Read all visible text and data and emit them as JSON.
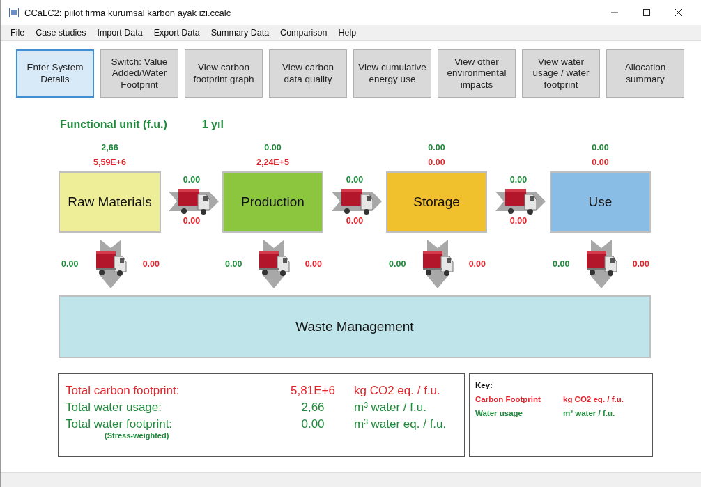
{
  "window": {
    "title": "CCaLC2: piilot firma kurumsal karbon ayak izi.ccalc"
  },
  "menu": [
    "File",
    "Case studies",
    "Import Data",
    "Export Data",
    "Summary Data",
    "Comparison",
    "Help"
  ],
  "toolbar": [
    {
      "label": "Enter System Details",
      "selected": true
    },
    {
      "label": "Switch: Value Added/Water Footprint",
      "selected": false
    },
    {
      "label": "View carbon footprint graph",
      "selected": false
    },
    {
      "label": "View carbon data quality",
      "selected": false
    },
    {
      "label": "View cumulative energy use",
      "selected": false
    },
    {
      "label": "View other environmental impacts",
      "selected": false
    },
    {
      "label": "View water usage / water footprint",
      "selected": false
    },
    {
      "label": "Allocation summary",
      "selected": false
    }
  ],
  "functional_unit": {
    "label": "Functional unit (f.u.)",
    "value": "1 yıl"
  },
  "stages": [
    {
      "name": "Raw Materials",
      "color": "#eeee99",
      "water": "2,66",
      "carbon": "5,59E+6",
      "transport": {
        "water": "0.00",
        "carbon": "0.00"
      },
      "waste_transport": {
        "water": "0.00",
        "carbon": "0.00"
      }
    },
    {
      "name": "Production",
      "color": "#8cc63f",
      "water": "0.00",
      "carbon": "2,24E+5",
      "transport": {
        "water": "0.00",
        "carbon": "0.00"
      },
      "waste_transport": {
        "water": "0.00",
        "carbon": "0.00"
      }
    },
    {
      "name": "Storage",
      "color": "#f0c12c",
      "water": "0.00",
      "carbon": "0.00",
      "transport": {
        "water": "0.00",
        "carbon": "0.00"
      },
      "waste_transport": {
        "water": "0.00",
        "carbon": "0.00"
      }
    },
    {
      "name": "Use",
      "color": "#89bde6",
      "water": "0.00",
      "carbon": "0.00",
      "waste_transport": {
        "water": "0.00",
        "carbon": "0.00"
      }
    }
  ],
  "waste_management": "Waste Management",
  "totals": [
    {
      "kind": "carbon",
      "label": "Total carbon footprint:",
      "value": "5,81E+6",
      "unit": "kg CO2 eq. / f.u."
    },
    {
      "kind": "water",
      "label": "Total water usage:",
      "value": "2,66",
      "unit": "m³ water / f.u."
    },
    {
      "kind": "water",
      "label": "Total water footprint:",
      "note": "(Stress-weighted)",
      "value": "0.00",
      "unit": "m³ water eq. / f.u."
    }
  ],
  "key": {
    "title": "Key:",
    "rows": [
      {
        "kind": "carbon",
        "label": "Carbon Footprint",
        "unit": "kg CO2 eq. / f.u."
      },
      {
        "kind": "water",
        "label": "Water usage",
        "unit": "m³ water / f.u."
      }
    ]
  }
}
